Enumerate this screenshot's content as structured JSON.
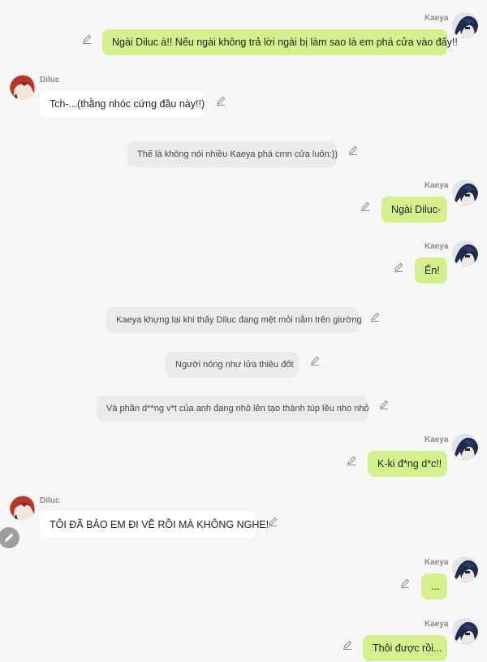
{
  "messages": [
    {
      "type": "right",
      "name": "Kaeya",
      "text": "Ngài Diluc à!! Nếu ngài không trả lời ngài bị làm sao là em phá cửa vào đấy!!"
    },
    {
      "type": "left",
      "name": "Diluc",
      "text": "Tch-...(thằng nhóc cứng đầu này!!)"
    },
    {
      "type": "narration",
      "text": "Thế là không nói nhiều Kaeya phá cmn cửa luôn:))"
    },
    {
      "type": "right",
      "name": "Kaeya",
      "text": "Ngài Diluc-"
    },
    {
      "type": "right",
      "name": "Kaeya",
      "text": "Ển!"
    },
    {
      "type": "narration",
      "text": "Kaeya khựng lại khi thấy Diluc đang mệt mỏi nằm trên giường"
    },
    {
      "type": "narration",
      "text": "Người nóng như lửa thiêu đốt"
    },
    {
      "type": "narration",
      "text": "Và phần d**ng v*t của anh đang nhô lên tạo thành túp lều nho nhỏ"
    },
    {
      "type": "right",
      "name": "Kaeya",
      "text": "K-ki đ*ng d*c!!"
    },
    {
      "type": "left",
      "name": "Diluc",
      "text": "TÔI ĐÃ BẢO EM ĐI VỀ RỒI MÀ KHÔNG NGHE!"
    },
    {
      "type": "right",
      "name": "Kaeya",
      "text": "..."
    },
    {
      "type": "right",
      "name": "Kaeya",
      "text": "Thôi được rồi..."
    }
  ],
  "icons": {
    "edit": "pencil-icon",
    "fab": "edit-fab-icon",
    "avatar_kaeya": "kaeya-avatar",
    "avatar_diluc": "diluc-avatar"
  },
  "colors": {
    "background": "#f6f6f6",
    "bubble_right": "#d4f08c",
    "bubble_left": "#ffffff",
    "narration": "#ebebeb",
    "name": "#8a8a8a",
    "fab": "#9e9e9e"
  }
}
